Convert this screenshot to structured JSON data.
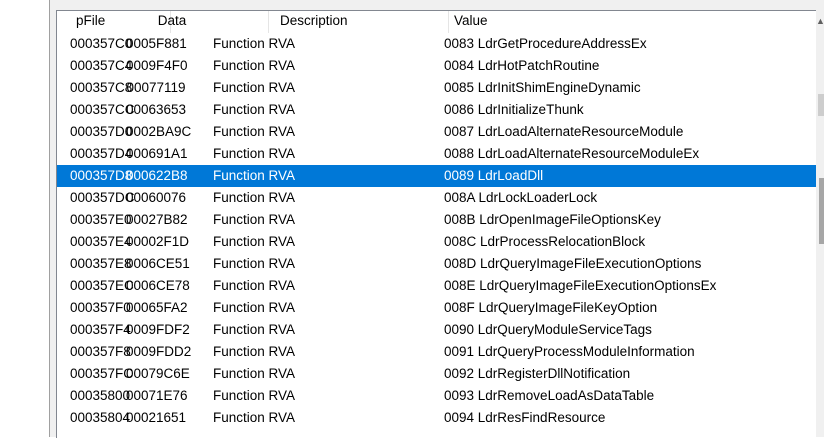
{
  "columns": {
    "pfile": "pFile",
    "data": "Data",
    "description": "Description",
    "value": "Value"
  },
  "selected_index": 6,
  "rows": [
    {
      "pfile": "000357C0",
      "data": "0005F881",
      "description": "Function RVA",
      "value": "0083  LdrGetProcedureAddressEx"
    },
    {
      "pfile": "000357C4",
      "data": "0009F4F0",
      "description": "Function RVA",
      "value": "0084  LdrHotPatchRoutine"
    },
    {
      "pfile": "000357C8",
      "data": "00077119",
      "description": "Function RVA",
      "value": "0085  LdrInitShimEngineDynamic"
    },
    {
      "pfile": "000357CC",
      "data": "00063653",
      "description": "Function RVA",
      "value": "0086  LdrInitializeThunk"
    },
    {
      "pfile": "000357D0",
      "data": "0002BA9C",
      "description": "Function RVA",
      "value": "0087  LdrLoadAlternateResourceModule"
    },
    {
      "pfile": "000357D4",
      "data": "000691A1",
      "description": "Function RVA",
      "value": "0088  LdrLoadAlternateResourceModuleEx"
    },
    {
      "pfile": "000357D8",
      "data": "000622B8",
      "description": "Function RVA",
      "value": "0089  LdrLoadDll"
    },
    {
      "pfile": "000357DC",
      "data": "00060076",
      "description": "Function RVA",
      "value": "008A  LdrLockLoaderLock"
    },
    {
      "pfile": "000357E0",
      "data": "00027B82",
      "description": "Function RVA",
      "value": "008B  LdrOpenImageFileOptionsKey"
    },
    {
      "pfile": "000357E4",
      "data": "00002F1D",
      "description": "Function RVA",
      "value": "008C  LdrProcessRelocationBlock"
    },
    {
      "pfile": "000357E8",
      "data": "0006CE51",
      "description": "Function RVA",
      "value": "008D  LdrQueryImageFileExecutionOptions"
    },
    {
      "pfile": "000357EC",
      "data": "0006CE78",
      "description": "Function RVA",
      "value": "008E  LdrQueryImageFileExecutionOptionsEx"
    },
    {
      "pfile": "000357F0",
      "data": "00065FA2",
      "description": "Function RVA",
      "value": "008F  LdrQueryImageFileKeyOption"
    },
    {
      "pfile": "000357F4",
      "data": "0009FDF2",
      "description": "Function RVA",
      "value": "0090  LdrQueryModuleServiceTags"
    },
    {
      "pfile": "000357F8",
      "data": "0009FDD2",
      "description": "Function RVA",
      "value": "0091  LdrQueryProcessModuleInformation"
    },
    {
      "pfile": "000357FC",
      "data": "00079C6E",
      "description": "Function RVA",
      "value": "0092  LdrRegisterDllNotification"
    },
    {
      "pfile": "00035800",
      "data": "00071E76",
      "description": "Function RVA",
      "value": "0093  LdrRemoveLoadAsDataTable"
    },
    {
      "pfile": "00035804",
      "data": "00021651",
      "description": "Function RVA",
      "value": "0094  LdrResFindResource"
    }
  ],
  "colors": {
    "selection": "#0078d7",
    "selection_text": "#ffffff",
    "border": "#828790"
  },
  "icons": {
    "scroll_up": "chevron-up-icon"
  }
}
